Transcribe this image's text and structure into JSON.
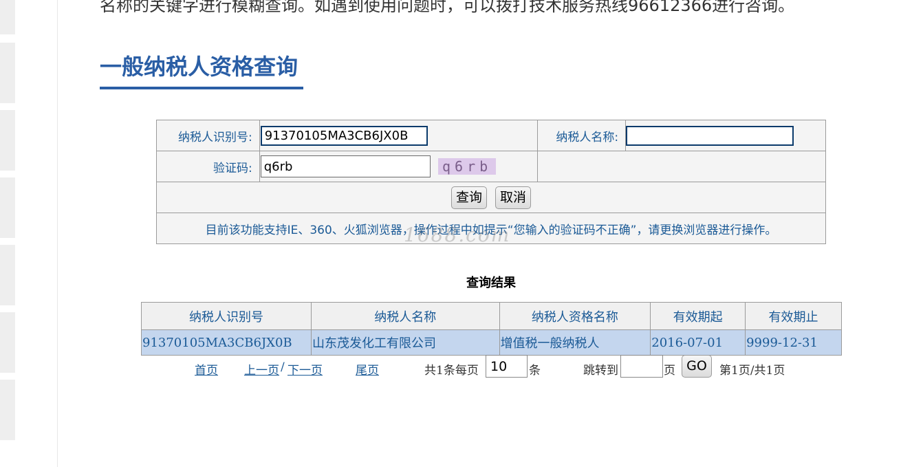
{
  "intro_text": "名称的关键字进行模糊查询。如遇到使用问题时，可以拨打技术服务热线96612366进行咨询。",
  "page_title": "一般纳税人资格查询",
  "form": {
    "taxpayer_id_label": "纳税人识别号:",
    "taxpayer_id_value": "91370105MA3CB6JX0B",
    "taxpayer_name_label": "纳税人名称:",
    "taxpayer_name_value": "",
    "captcha_label": "验证码:",
    "captcha_value": "q6rb",
    "captcha_image_text": "q6rb",
    "query_button": "查询",
    "cancel_button": "取消",
    "notice": "目前该功能支持IE、360、火狐浏览器，操作过程中如提示“您输入的验证码不正确”，请更换浏览器进行操作。"
  },
  "watermark": "1688.com",
  "results": {
    "title": "查询结果",
    "columns": [
      "纳税人识别号",
      "纳税人名称",
      "纳税人资格名称",
      "有效期起",
      "有效期止"
    ],
    "rows": [
      [
        "91370105MA3CB6JX0B",
        "山东茂发化工有限公司",
        "增值税一般纳税人",
        "2016-07-01",
        "9999-12-31"
      ]
    ]
  },
  "pager": {
    "first": "首页",
    "prev": "上一页",
    "separator": "/",
    "next": "下一页",
    "last": "尾页",
    "total_prefix": "共1条每页",
    "page_size": "10",
    "unit": "条",
    "jump_label": "跳转到",
    "jump_value": "",
    "page_unit": "页",
    "go_button": "GO",
    "page_status": "第1页/共1页"
  },
  "colors": {
    "accent": "#2a5ea5",
    "link": "#1b5a96",
    "row_highlight": "#c4d6ee"
  }
}
